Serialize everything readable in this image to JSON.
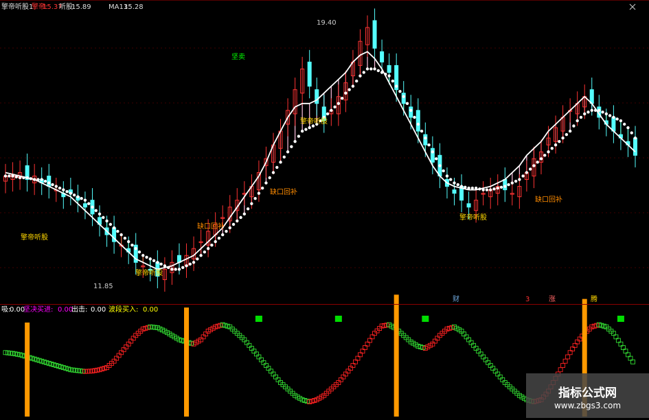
{
  "header": {
    "indicator_name": "擎帝听股1",
    "field1_label": "擎帝:",
    "field1_value": "15.37",
    "field2_label": "听股:",
    "field2_value": "15.89",
    "field3_label": "MA13:",
    "field3_value": "15.28"
  },
  "sub_header": {
    "items": [
      {
        "label": "吸:",
        "value": "0.00",
        "color": "#ffffff"
      },
      {
        "label": "坚决买进:",
        "value": "0.00",
        "color": "#ff00ff"
      },
      {
        "label": "出击:",
        "value": "0.00",
        "color": "#ffffff"
      },
      {
        "label": "波段买入:",
        "value": "0.00",
        "color": "#ffff00"
      }
    ]
  },
  "annotations": {
    "high_label": "19.40",
    "low_label": "11.85",
    "signals": [
      {
        "text": "擎帝听股",
        "color": "#ffd700"
      },
      {
        "text": "坚卖",
        "color": "#00ff00"
      },
      {
        "text": "缺口回补",
        "color": "#ff8c00"
      },
      {
        "text": "擎帝听股",
        "color": "#ffd700"
      },
      {
        "text": "擎帝听股",
        "color": "#ffd700"
      },
      {
        "text": "缺口回补",
        "color": "#ff8c00"
      },
      {
        "text": "擎帝听股",
        "color": "#ffd700"
      },
      {
        "text": "缺口回补",
        "color": "#ff8c00"
      }
    ],
    "markers": [
      {
        "text": "财",
        "color": "#6fa8dc"
      },
      {
        "text": "3",
        "color": "#ff3333"
      },
      {
        "text": "涨",
        "color": "#ff6666"
      },
      {
        "text": "腾",
        "color": "#ffd700"
      }
    ]
  },
  "colors": {
    "up": "#ff3333",
    "down": "#54ffff",
    "ma_line": "#ffffff",
    "dotted_line": "#ffffff",
    "buy_hatch": "#ffc0e0",
    "sell_hatch": "#66ff66",
    "osc_up": "#ff2222",
    "osc_down": "#33dd33",
    "bar": "#ff9900",
    "signal_square": "#00dd00",
    "divider": "#8b0000"
  },
  "watermark": {
    "title": "指标公式网",
    "url": "www.zbgs3.com"
  },
  "chart_data": {
    "type": "candlestick",
    "ylim": [
      11.85,
      19.4
    ],
    "close": [
      14.9,
      14.95,
      15.0,
      14.8,
      14.9,
      14.7,
      14.6,
      14.5,
      14.3,
      14.4,
      14.2,
      14.0,
      13.8,
      13.5,
      13.2,
      13.0,
      12.9,
      12.7,
      12.4,
      12.3,
      12.2,
      12.0,
      12.2,
      12.4,
      12.4,
      12.6,
      12.8,
      13.0,
      13.3,
      13.5,
      13.7,
      14.0,
      14.2,
      14.4,
      14.6,
      15.0,
      15.4,
      15.8,
      16.2,
      16.8,
      17.4,
      18.0,
      17.5,
      17.0,
      16.5,
      16.8,
      17.2,
      17.6,
      18.2,
      18.8,
      19.2,
      18.6,
      18.2,
      17.9,
      17.4,
      17.0,
      16.6,
      16.2,
      15.8,
      15.3,
      14.9,
      14.6,
      14.4,
      14.2,
      14.0,
      14.2,
      14.4,
      14.5,
      14.6,
      14.5,
      14.4,
      14.6,
      15.0,
      15.4,
      15.6,
      16.0,
      16.3,
      16.6,
      16.8,
      17.0,
      17.2,
      17.0,
      16.6,
      16.4,
      16.2,
      16.0,
      15.8,
      15.5
    ],
    "ma13": [
      15.0,
      14.95,
      14.9,
      14.85,
      14.8,
      14.7,
      14.6,
      14.5,
      14.4,
      14.3,
      14.1,
      13.9,
      13.7,
      13.5,
      13.3,
      13.1,
      12.9,
      12.7,
      12.5,
      12.4,
      12.3,
      12.2,
      12.25,
      12.3,
      12.4,
      12.5,
      12.6,
      12.8,
      13.0,
      13.2,
      13.4,
      13.7,
      14.0,
      14.3,
      14.6,
      14.9,
      15.3,
      15.8,
      16.2,
      16.6,
      16.9,
      17.0,
      17.0,
      17.1,
      17.3,
      17.5,
      17.7,
      17.9,
      18.2,
      18.4,
      18.5,
      18.3,
      18.0,
      17.6,
      17.2,
      16.8,
      16.4,
      16.0,
      15.6,
      15.2,
      14.9,
      14.7,
      14.6,
      14.55,
      14.5,
      14.5,
      14.55,
      14.6,
      14.7,
      14.8,
      15.0,
      15.2,
      15.5,
      15.7,
      15.9,
      16.2,
      16.4,
      16.6,
      16.8,
      17.0,
      17.2,
      17.0,
      16.7,
      16.4,
      16.2,
      16.0,
      15.8,
      15.6
    ],
    "dotted": [
      14.9,
      14.9,
      14.85,
      14.85,
      14.8,
      14.8,
      14.7,
      14.6,
      14.5,
      14.4,
      14.3,
      14.2,
      14.0,
      13.8,
      13.6,
      13.4,
      13.2,
      13.0,
      12.8,
      12.6,
      12.5,
      12.4,
      12.3,
      12.2,
      12.2,
      12.3,
      12.4,
      12.6,
      12.8,
      13.0,
      13.2,
      13.4,
      13.6,
      13.8,
      14.1,
      14.4,
      14.7,
      15.0,
      15.3,
      15.6,
      15.9,
      16.2,
      16.3,
      16.4,
      16.6,
      16.8,
      17.0,
      17.3,
      17.5,
      17.8,
      18.0,
      18.0,
      17.9,
      17.8,
      17.5,
      17.2,
      16.8,
      16.4,
      16.0,
      15.6,
      15.2,
      14.9,
      14.7,
      14.6,
      14.55,
      14.55,
      14.5,
      14.5,
      14.55,
      14.6,
      14.7,
      14.8,
      15.0,
      15.2,
      15.4,
      15.6,
      15.8,
      16.0,
      16.2,
      16.5,
      16.7,
      16.8,
      16.8,
      16.7,
      16.6,
      16.5,
      16.3,
      16.0
    ],
    "oscillator": [
      0.3,
      0.28,
      0.25,
      0.2,
      0.15,
      0.1,
      0.05,
      0.0,
      -0.05,
      -0.1,
      -0.12,
      -0.14,
      -0.13,
      -0.1,
      -0.05,
      0.1,
      0.3,
      0.5,
      0.7,
      0.85,
      0.9,
      0.88,
      0.8,
      0.7,
      0.6,
      0.55,
      0.5,
      0.6,
      0.8,
      0.9,
      0.95,
      0.9,
      0.75,
      0.6,
      0.4,
      0.2,
      0.0,
      -0.2,
      -0.4,
      -0.55,
      -0.7,
      -0.8,
      -0.85,
      -0.8,
      -0.7,
      -0.55,
      -0.4,
      -0.2,
      0.0,
      0.25,
      0.5,
      0.75,
      0.92,
      0.95,
      0.85,
      0.7,
      0.55,
      0.45,
      0.4,
      0.5,
      0.7,
      0.85,
      0.9,
      0.8,
      0.6,
      0.4,
      0.2,
      0.0,
      -0.2,
      -0.4,
      -0.55,
      -0.7,
      -0.8,
      -0.85,
      -0.8,
      -0.6,
      -0.3,
      0.0,
      0.3,
      0.55,
      0.75,
      0.9,
      0.95,
      0.9,
      0.75,
      0.5,
      0.25,
      0.0
    ],
    "bars_at": [
      3,
      25,
      54,
      80
    ],
    "bar_height": 1.0,
    "signal_squares_at": [
      35,
      46,
      58,
      85
    ]
  }
}
